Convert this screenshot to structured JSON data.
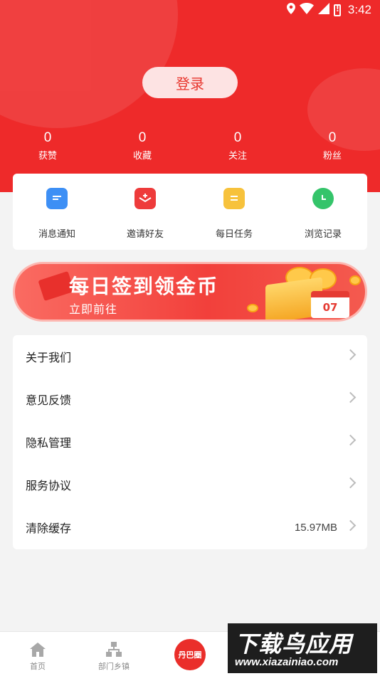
{
  "status_bar": {
    "time": "3:42",
    "icons": [
      "location-icon",
      "wifi-icon",
      "signal-icon",
      "battery-alert-icon"
    ]
  },
  "header": {
    "login_label": "登录",
    "background_color": "#ee2a2a"
  },
  "stats": [
    {
      "value": "0",
      "label": "获赞"
    },
    {
      "value": "0",
      "label": "收藏"
    },
    {
      "value": "0",
      "label": "关注"
    },
    {
      "value": "0",
      "label": "粉丝"
    }
  ],
  "quick_actions": [
    {
      "label": "消息通知",
      "icon": "message-icon",
      "color": "#3d8ff5"
    },
    {
      "label": "邀请好友",
      "icon": "invite-envelope-icon",
      "color": "#ee3b3b"
    },
    {
      "label": "每日任务",
      "icon": "task-list-icon",
      "color": "#f7c23c"
    },
    {
      "label": "浏览记录",
      "icon": "clock-icon",
      "color": "#34c46a"
    }
  ],
  "banner": {
    "title": "每日签到领金币",
    "subtitle": "立即前往",
    "calendar_day": "07"
  },
  "menu": [
    {
      "label": "关于我们",
      "value": ""
    },
    {
      "label": "意见反馈",
      "value": ""
    },
    {
      "label": "隐私管理",
      "value": ""
    },
    {
      "label": "服务协议",
      "value": ""
    },
    {
      "label": "清除缓存",
      "value": "15.97MB"
    }
  ],
  "tabbar": {
    "tabs": [
      {
        "label": "首页",
        "icon": "home-icon"
      },
      {
        "label": "部门乡镇",
        "icon": "org-chart-icon"
      }
    ],
    "center_label": "丹巴圈"
  },
  "watermark": {
    "line1": "下载鸟应用",
    "line2": "www.xiazainiao.com"
  }
}
